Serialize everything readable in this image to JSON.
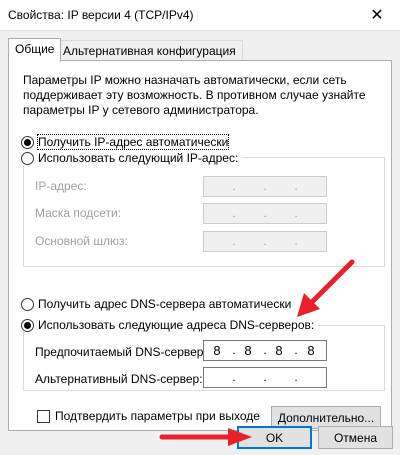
{
  "window": {
    "title": "Свойства: IP версии 4 (TCP/IPv4)",
    "close_symbol": "✕"
  },
  "tabs": [
    {
      "label": "Общие",
      "active": true
    },
    {
      "label": "Альтернативная конфигурация",
      "active": false
    }
  ],
  "intro_text": "Параметры IP можно назначать автоматически, если сеть поддерживает эту возможность. В противном случае узнайте параметры IP у сетевого администратора.",
  "ip": {
    "auto_label": "Получить IP-адрес автоматически",
    "auto_selected": true,
    "manual_label": "Использовать следующий IP-адрес:",
    "manual_selected": false,
    "fields": [
      {
        "label": "IP-адрес:",
        "value": [
          "",
          "",
          "",
          ""
        ],
        "enabled": false
      },
      {
        "label": "Маска подсети:",
        "value": [
          "",
          "",
          "",
          ""
        ],
        "enabled": false
      },
      {
        "label": "Основной шлюз:",
        "value": [
          "",
          "",
          "",
          ""
        ],
        "enabled": false
      }
    ]
  },
  "dns": {
    "auto_label": "Получить адрес DNS-сервера автоматически",
    "auto_selected": false,
    "manual_label": "Использовать следующие адреса DNS-серверов:",
    "manual_selected": true,
    "preferred_label": "Предпочитаемый DNS-сервер:",
    "preferred_value": [
      "8",
      "8",
      "8",
      "8"
    ],
    "alternate_label": "Альтернативный DNS-сервер:",
    "alternate_value": [
      "",
      "",
      "",
      ""
    ]
  },
  "validate_label": "Подтвердить параметры при выходе",
  "validate_checked": false,
  "buttons": {
    "advanced": "Дополнительно...",
    "ok": "OK",
    "cancel": "Отмена"
  },
  "colors": {
    "annotation_arrow": "#e8202a",
    "default_button_border": "#0078d7"
  }
}
